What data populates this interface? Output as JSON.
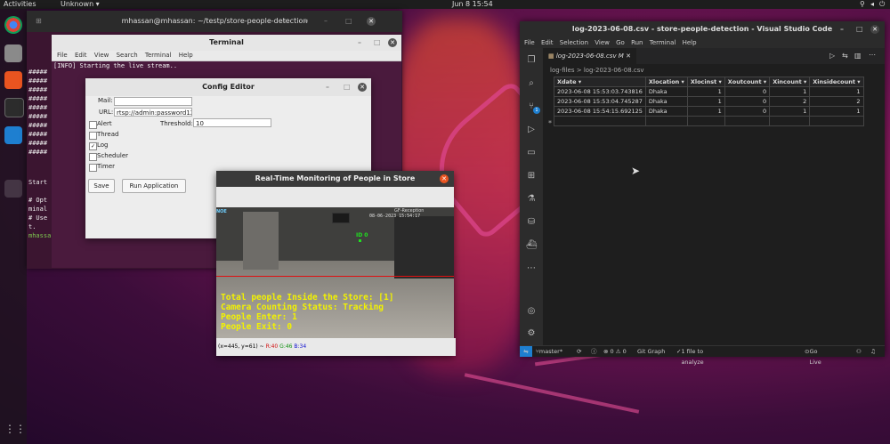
{
  "topbar": {
    "activities": "Activities",
    "app": "Unknown ▾",
    "clock": "Jun 8  15:54"
  },
  "terminal": {
    "title": "mhassan@mhassan: ~/testp/store-people-detection",
    "hash_lines": [
      "#####",
      "#####",
      "#####",
      "#####",
      "#####",
      "#####",
      "#####",
      "#####",
      "#####",
      "#####"
    ],
    "lines_lower": [
      "Start",
      "",
      "# Opt",
      "minal",
      "# Use",
      "t.",
      "mhassa"
    ]
  },
  "inner_terminal": {
    "title": "Terminal",
    "menu": [
      "File",
      "Edit",
      "View",
      "Search",
      "Terminal",
      "Help"
    ],
    "first_line": "[INFO] Starting the live stream.."
  },
  "config": {
    "title": "Config Editor",
    "mail_label": "Mail:",
    "mail_value": "",
    "url_label": "URL:",
    "url_value": "rtsp://admin:password12",
    "threshold_label": "Threshold:",
    "threshold_value": "10",
    "checks": [
      {
        "label": "Alert",
        "checked": false
      },
      {
        "label": "Thread",
        "checked": false
      },
      {
        "label": "Log",
        "checked": true
      },
      {
        "label": "Scheduler",
        "checked": false
      },
      {
        "label": "Timer",
        "checked": false
      }
    ],
    "save": "Save",
    "run": "Run Application"
  },
  "monitor": {
    "title": "Real-Time Monitoring of People in Store",
    "overlay": [
      "Total people Inside the Store: [1]",
      "Camera Counting Status: Tracking",
      "People Enter: 1",
      "People Exit: 0"
    ],
    "cam_label": "NOE",
    "timestamp": "08-06-2023 15:54:17",
    "reception": "GF-Reception",
    "track_id": "ID 0",
    "status_coords": "(x=445, y=61) ~",
    "status_r": "R:40",
    "status_g": "G:46",
    "status_b": "B:34"
  },
  "vscode": {
    "title": "log-2023-06-08.csv - store-people-detection - Visual Studio Code",
    "menu": [
      "File",
      "Edit",
      "Selection",
      "View",
      "Go",
      "Run",
      "Terminal",
      "Help"
    ],
    "tab": "log-2023-06-08.csv M",
    "breadcrumb": "log-files  >  log-2023-06-08.csv",
    "source_control_badge": "1",
    "columns": [
      "Xdate",
      "Xlocation",
      "Xlocinst",
      "Xoutcount",
      "Xincount",
      "Xinsidecount"
    ],
    "rows": [
      [
        "2023-06-08 15:53:03.743816",
        "Dhaka",
        "1",
        "0",
        "1",
        "1"
      ],
      [
        "2023-06-08 15:53:04.745287",
        "Dhaka",
        "1",
        "0",
        "2",
        "2"
      ],
      [
        "2023-06-08 15:54:15.692125",
        "Dhaka",
        "1",
        "0",
        "1",
        "1"
      ]
    ],
    "status": {
      "branch": "master*",
      "problems": "⊗ 0 ⚠ 0",
      "git_graph": "Git Graph",
      "analyze": "1 file to analyze",
      "golive": "Go Live"
    }
  },
  "colors": {
    "accent_orange": "#e95420",
    "overlay_yellow": "#f2f200",
    "line_red": "#e01010"
  }
}
